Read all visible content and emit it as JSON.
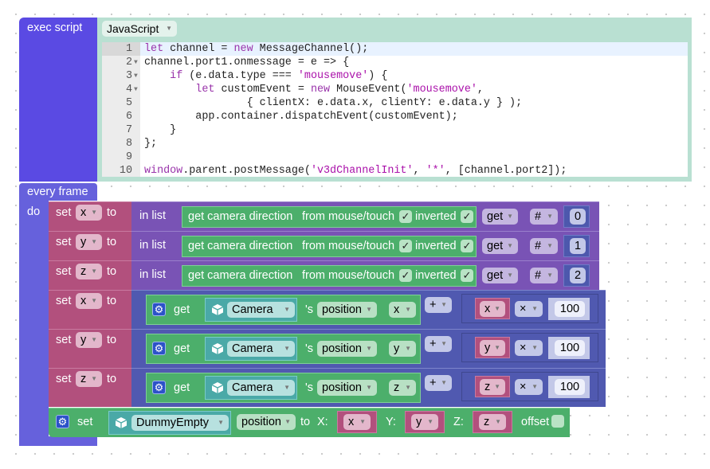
{
  "exec_block": {
    "label": "exec script",
    "language": "JavaScript",
    "code": [
      [
        [
          "let",
          "kw"
        ],
        [
          " channel = ",
          ""
        ],
        [
          "new",
          "kw"
        ],
        [
          " MessageChannel();",
          ""
        ]
      ],
      [
        [
          "channel.port1.onmessage = e => {",
          ""
        ]
      ],
      [
        [
          "    ",
          ""
        ],
        [
          "if",
          "kw"
        ],
        [
          " (e.data.type === ",
          ""
        ],
        [
          "'mousemove'",
          "str"
        ],
        [
          ") {",
          ""
        ]
      ],
      [
        [
          "        ",
          ""
        ],
        [
          "let",
          "kw"
        ],
        [
          " customEvent = ",
          ""
        ],
        [
          "new",
          "kw"
        ],
        [
          " MouseEvent(",
          ""
        ],
        [
          "'mousemove'",
          "str"
        ],
        [
          ",",
          ""
        ]
      ],
      [
        [
          "                { clientX: e.data.x, clientY: e.data.y } );",
          ""
        ]
      ],
      [
        [
          "        app.container.dispatchEvent(customEvent);",
          ""
        ]
      ],
      [
        [
          "    }",
          ""
        ]
      ],
      [
        [
          "};",
          ""
        ]
      ],
      [],
      [
        [
          "window",
          "kw"
        ],
        [
          ".parent.postMessage(",
          ""
        ],
        [
          "'v3dChannelInit'",
          "str"
        ],
        [
          ", ",
          ""
        ],
        [
          "'*'",
          "str"
        ],
        [
          ", [channel.port2]);",
          ""
        ]
      ]
    ],
    "line_numbers": [
      "1",
      "2",
      "3",
      "4",
      "5",
      "6",
      "7",
      "8",
      "9",
      "10"
    ],
    "foldable_lines": [
      2,
      3,
      4
    ]
  },
  "every_frame": {
    "label": "every frame",
    "do_label": "do"
  },
  "list_rows": [
    {
      "set": "set",
      "var": "x",
      "to": "to",
      "in_list": "in list",
      "get_dir": "get camera direction",
      "from": "from mouse/touch",
      "inverted": "inverted",
      "check": "✓",
      "get": "get",
      "hash": "#",
      "index": "0"
    },
    {
      "set": "set",
      "var": "y",
      "to": "to",
      "in_list": "in list",
      "get_dir": "get camera direction",
      "from": "from mouse/touch",
      "inverted": "inverted",
      "check": "✓",
      "get": "get",
      "hash": "#",
      "index": "1"
    },
    {
      "set": "set",
      "var": "z",
      "to": "to",
      "in_list": "in list",
      "get_dir": "get camera direction",
      "from": "from mouse/touch",
      "inverted": "inverted",
      "check": "✓",
      "get": "get",
      "hash": "#",
      "index": "2"
    }
  ],
  "math_rows": [
    {
      "set": "set",
      "var": "x",
      "to": "to",
      "get": "get",
      "object": "Camera",
      "s": "'s",
      "prop": "position",
      "axis": "x",
      "op": "+",
      "var2": "x",
      "mul": "×",
      "num": "100"
    },
    {
      "set": "set",
      "var": "y",
      "to": "to",
      "get": "get",
      "object": "Camera",
      "s": "'s",
      "prop": "position",
      "axis": "y",
      "op": "+",
      "var2": "y",
      "mul": "×",
      "num": "100"
    },
    {
      "set": "set",
      "var": "z",
      "to": "to",
      "get": "get",
      "object": "Camera",
      "s": "'s",
      "prop": "position",
      "axis": "z",
      "op": "+",
      "var2": "z",
      "mul": "×",
      "num": "100"
    }
  ],
  "dummy_row": {
    "set": "set",
    "object": "DummyEmpty",
    "prop": "position",
    "to": "to",
    "x_label": "X:",
    "x": "x",
    "y_label": "Y:",
    "y": "y",
    "z_label": "Z:",
    "z": "z",
    "offset": "offset"
  },
  "arrow": "▾",
  "colors": {
    "exec": "#5a4ae3",
    "exec_input": "#b9e0d2",
    "loop": "#6661dc",
    "set_var": "#b2507d",
    "list": "#7953b5",
    "math": "#5059b0",
    "object": "#4caf6b",
    "object_ref": "#4aa9a7"
  }
}
